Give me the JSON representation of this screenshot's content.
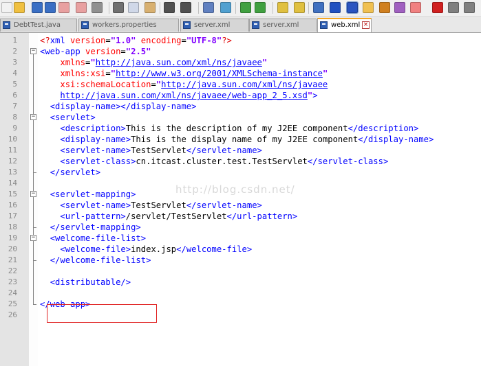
{
  "toolbar": {
    "buttons": [
      {
        "name": "new-file-icon",
        "color": "#f2f2f2"
      },
      {
        "name": "open-file-icon",
        "color": "#f0c040"
      },
      {
        "name": "save-icon",
        "color": "#3a6fc4"
      },
      {
        "name": "save-all-icon",
        "color": "#3a6fc4"
      },
      {
        "name": "close-icon",
        "color": "#e8a0a0"
      },
      {
        "name": "close-all-icon",
        "color": "#e8a0a0"
      },
      {
        "name": "print-icon",
        "color": "#909090"
      },
      {
        "name": "cut-icon",
        "color": "#707070"
      },
      {
        "name": "copy-icon",
        "color": "#d0d8e8"
      },
      {
        "name": "paste-icon",
        "color": "#d8b070"
      },
      {
        "name": "undo-icon",
        "color": "#505050"
      },
      {
        "name": "redo-icon",
        "color": "#505050"
      },
      {
        "name": "find-icon",
        "color": "#6080c0"
      },
      {
        "name": "replace-icon",
        "color": "#50a0d0"
      },
      {
        "name": "zoom-in-icon",
        "color": "#40a040"
      },
      {
        "name": "zoom-out-icon",
        "color": "#40a040"
      },
      {
        "name": "sync-vertical-icon",
        "color": "#e0c040"
      },
      {
        "name": "sync-horizontal-icon",
        "color": "#e0c040"
      },
      {
        "name": "word-wrap-icon",
        "color": "#4070c0"
      },
      {
        "name": "show-all-characters-icon",
        "color": "#2050c0"
      },
      {
        "name": "indent-guide-icon",
        "color": "#2a54c0"
      },
      {
        "name": "folder-as-workspace-icon",
        "color": "#f0c050"
      },
      {
        "name": "document-map-icon",
        "color": "#d08020"
      },
      {
        "name": "function-list-icon",
        "color": "#a060c0"
      },
      {
        "name": "folder-icon",
        "color": "#f08080"
      },
      {
        "name": "record-macro-icon",
        "color": "#d02020"
      },
      {
        "name": "stop-recording-icon",
        "color": "#808080"
      },
      {
        "name": "playback-icon",
        "color": "#808080"
      }
    ]
  },
  "tabs": [
    {
      "label": "DebtTest.java",
      "active": false
    },
    {
      "label": "workers.properties",
      "active": false
    },
    {
      "label": "server.xml",
      "active": false
    },
    {
      "label": "server.xml",
      "active": false
    },
    {
      "label": "web.xml",
      "active": true
    }
  ],
  "editor": {
    "line_numbers": [
      "1",
      "2",
      "3",
      "4",
      "5",
      "6",
      "7",
      "8",
      "9",
      "10",
      "11",
      "12",
      "13",
      "14",
      "15",
      "16",
      "17",
      "18",
      "19",
      "20",
      "21",
      "22",
      "23",
      "24",
      "25",
      "26"
    ],
    "watermark": "http://blog.csdn.net/",
    "lines": [
      [
        [
          "pi",
          "<?"
        ],
        [
          "tag",
          "xml "
        ],
        [
          "attr",
          "version"
        ],
        [
          "txt",
          "="
        ],
        [
          "val",
          "\"1.0\""
        ],
        [
          "txt",
          " "
        ],
        [
          "attr",
          "encoding"
        ],
        [
          "txt",
          "="
        ],
        [
          "val",
          "\"UTF-8\""
        ],
        [
          "pi",
          "?>"
        ]
      ],
      [
        [
          "tag",
          "<web-app "
        ],
        [
          "attr",
          "version"
        ],
        [
          "txt",
          "="
        ],
        [
          "val",
          "\"2.5\""
        ]
      ],
      [
        [
          "txt",
          "    "
        ],
        [
          "attr",
          "xmlns"
        ],
        [
          "txt",
          "="
        ],
        [
          "val",
          "\""
        ],
        [
          "link",
          "http://java.sun.com/xml/ns/javaee"
        ],
        [
          "val",
          "\""
        ]
      ],
      [
        [
          "txt",
          "    "
        ],
        [
          "attr",
          "xmlns:xsi"
        ],
        [
          "txt",
          "="
        ],
        [
          "val",
          "\""
        ],
        [
          "link",
          "http://www.w3.org/2001/XMLSchema-instance"
        ],
        [
          "val",
          "\""
        ]
      ],
      [
        [
          "txt",
          "    "
        ],
        [
          "attr",
          "xsi:schemaLocation"
        ],
        [
          "txt",
          "="
        ],
        [
          "val",
          "\""
        ],
        [
          "link",
          "http://java.sun.com/xml/ns/javaee"
        ]
      ],
      [
        [
          "txt",
          "    "
        ],
        [
          "link",
          "http://java.sun.com/xml/ns/javaee/web-app_2_5.xsd"
        ],
        [
          "val",
          "\""
        ],
        [
          "tag",
          ">"
        ]
      ],
      [
        [
          "txt",
          "  "
        ],
        [
          "tag",
          "<display-name></display-name>"
        ]
      ],
      [
        [
          "txt",
          "  "
        ],
        [
          "tag",
          "<servlet>"
        ]
      ],
      [
        [
          "txt",
          "    "
        ],
        [
          "tag",
          "<description>"
        ],
        [
          "txt",
          "This is the description of my J2EE component"
        ],
        [
          "tag",
          "</description>"
        ]
      ],
      [
        [
          "txt",
          "    "
        ],
        [
          "tag",
          "<display-name>"
        ],
        [
          "txt",
          "This is the display name of my J2EE component"
        ],
        [
          "tag",
          "</display-name>"
        ]
      ],
      [
        [
          "txt",
          "    "
        ],
        [
          "tag",
          "<servlet-name>"
        ],
        [
          "txt",
          "TestServlet"
        ],
        [
          "tag",
          "</servlet-name>"
        ]
      ],
      [
        [
          "txt",
          "    "
        ],
        [
          "tag",
          "<servlet-class>"
        ],
        [
          "txt",
          "cn.itcast.cluster.test.TestServlet"
        ],
        [
          "tag",
          "</servlet-class>"
        ]
      ],
      [
        [
          "txt",
          "  "
        ],
        [
          "tag",
          "</servlet>"
        ]
      ],
      [],
      [
        [
          "txt",
          "  "
        ],
        [
          "tag",
          "<servlet-mapping>"
        ]
      ],
      [
        [
          "txt",
          "    "
        ],
        [
          "tag",
          "<servlet-name>"
        ],
        [
          "txt",
          "TestServlet"
        ],
        [
          "tag",
          "</servlet-name>"
        ]
      ],
      [
        [
          "txt",
          "    "
        ],
        [
          "tag",
          "<url-pattern>"
        ],
        [
          "txt",
          "/servlet/TestServlet"
        ],
        [
          "tag",
          "</url-pattern>"
        ]
      ],
      [
        [
          "txt",
          "  "
        ],
        [
          "tag",
          "</servlet-mapping>"
        ]
      ],
      [
        [
          "txt",
          "  "
        ],
        [
          "tag",
          "<welcome-file-list>"
        ]
      ],
      [
        [
          "txt",
          "    "
        ],
        [
          "tag",
          "<welcome-file>"
        ],
        [
          "txt",
          "index.jsp"
        ],
        [
          "tag",
          "</welcome-file>"
        ]
      ],
      [
        [
          "txt",
          "  "
        ],
        [
          "tag",
          "</welcome-file-list>"
        ]
      ],
      [],
      [
        [
          "txt",
          "  "
        ],
        [
          "tag",
          "<distributable/>"
        ]
      ],
      [],
      [
        [
          "tag",
          "</web-app>"
        ]
      ],
      []
    ]
  }
}
